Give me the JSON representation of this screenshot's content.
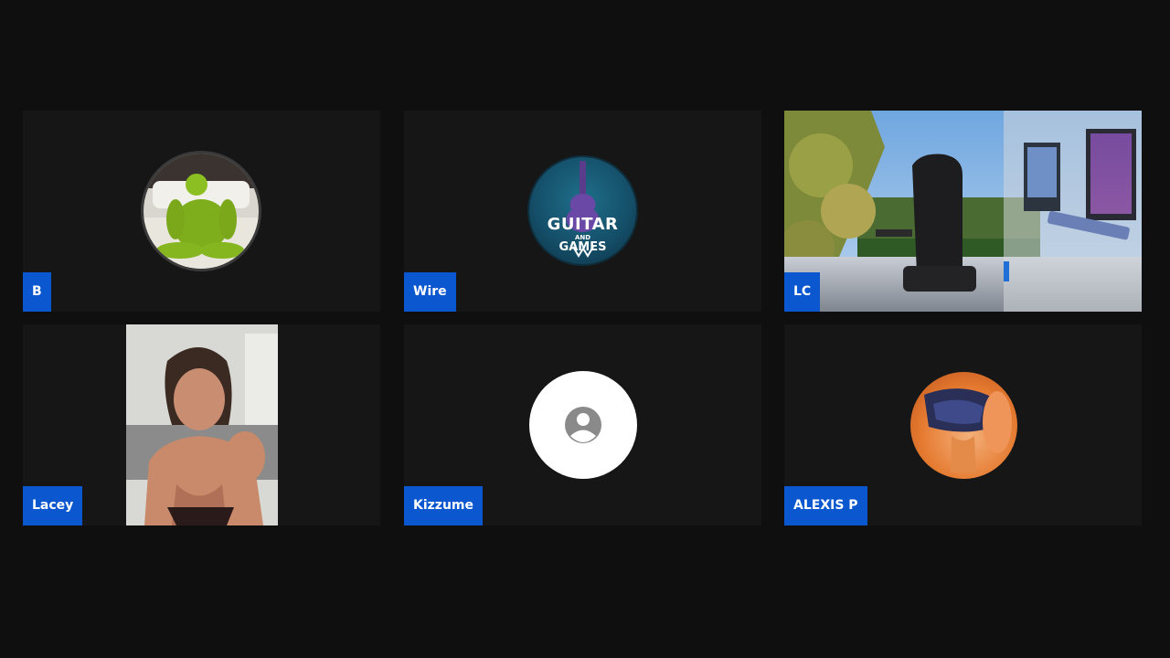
{
  "participants": [
    {
      "name": "B",
      "avatar_icon": "green-figure-avatar-icon"
    },
    {
      "name": "Wire",
      "avatar_icon": "guitar-and-games-logo-icon",
      "logo_text": {
        "line1": "GUITAR",
        "line2": "AND",
        "line3": "GAMES"
      }
    },
    {
      "name": "LC",
      "avatar_icon": "gaming-setup-video"
    },
    {
      "name": "Lacey",
      "avatar_icon": "webcam-video"
    },
    {
      "name": "Kizzume",
      "avatar_icon": "default-user-icon"
    },
    {
      "name": "ALEXIS P",
      "avatar_icon": "orange-photo-avatar-icon"
    }
  ],
  "colors": {
    "background": "#0f0f0f",
    "tile": "#161616",
    "name_tag": "#0b57d0",
    "name_text": "#ffffff"
  }
}
